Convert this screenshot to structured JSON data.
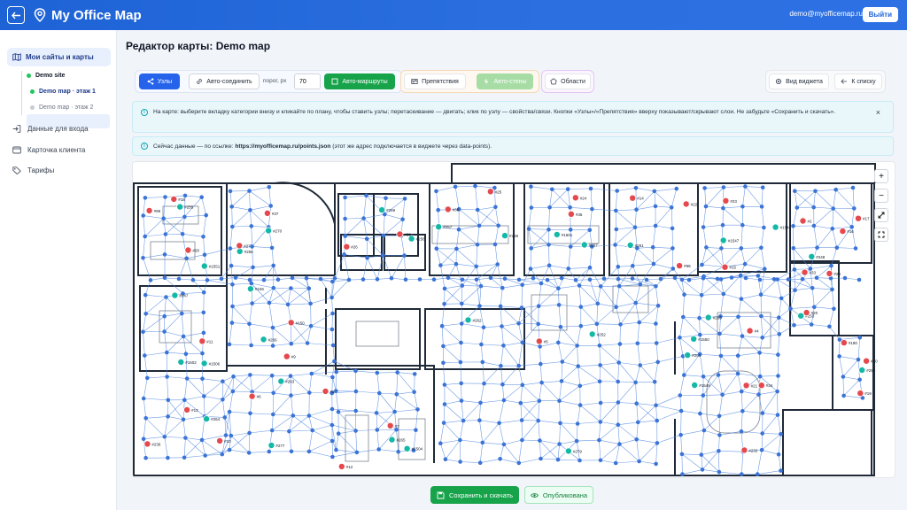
{
  "header": {
    "title": "My Office Map",
    "user_email": "demo@myofficemap.ru",
    "logout_label": "Выйти"
  },
  "sidebar": {
    "sites_label": "Мои сайты и карты",
    "site_name": "Demo site",
    "maps": [
      {
        "label": "Demo map · этаж 1",
        "active": true
      },
      {
        "label": "Demo map · этаж 2",
        "active": false
      }
    ],
    "nav": [
      {
        "label": "Данные для входа",
        "icon": "login-icon"
      },
      {
        "label": "Карточка клиента",
        "icon": "card-icon"
      },
      {
        "label": "Тарифы",
        "icon": "tag-icon"
      }
    ]
  },
  "page": {
    "title": "Редактор карты: Demo map"
  },
  "toolbar": {
    "nodes_label": "Узлы",
    "autoconnect_label": "Авто-соединить",
    "threshold_label": "порог, px",
    "threshold_value": "70",
    "autoroutes_label": "Авто-маршруты",
    "obstacles_label": "Препятствия",
    "autowalls_label": "Авто-стены",
    "areas_label": "Области",
    "widget_view_label": "Вид виджета",
    "back_to_list_label": "К списку"
  },
  "info": {
    "hint_text": "На карте: выберите вкладку категории внизу и кликайте по плану, чтобы ставить узлы; перетаскивание — двигать; клик по узлу — свойства/связи. Кнопки «Узлы»/«Препятствия» вверху показывают/скрывают слои. Не забудьте «Сохранить и скачать».",
    "data_prefix": "Сейчас данные — по ссылке:",
    "data_url": "https://myofficemap.ru/points.json",
    "data_suffix": "(этот же адрес подключается в виджете через data-points)."
  },
  "map": {
    "zoom_in": "+",
    "zoom_out": "−",
    "labels": [
      "#99",
      "#270",
      "#269",
      "#268",
      "#267",
      "#98",
      "#1547",
      "#248",
      "#1602",
      "#266",
      "#265",
      "#264",
      "#263",
      "#262",
      "#261",
      "#1549",
      "#253",
      "#254",
      "#255",
      "#256",
      "#258",
      "#257",
      "#1601",
      "#251",
      "#1548",
      "#2",
      "#1506",
      "#150",
      "#1504",
      "#236",
      "#277",
      "#279",
      "#283",
      "#232",
      "#29",
      "#30",
      "#28",
      "#27",
      "#26",
      "#25",
      "#24",
      "#14",
      "#15",
      "#16",
      "#11",
      "#9",
      "#7",
      "#10",
      "#8",
      "#252",
      "#1550",
      "#34",
      "#33",
      "#19",
      "#18",
      "#37",
      "#38",
      "#36",
      "#35",
      "#22",
      "#23",
      "#17",
      "#247",
      "#246",
      "#12",
      "#13",
      "#6",
      "#5",
      "#4",
      "#21",
      "#20",
      "#180",
      "#1551"
    ],
    "colors": {
      "node": "#3b74d6",
      "edge": "#4b83de",
      "desk_marker": "#e5484d",
      "meeting_marker": "#14b8a6",
      "wall": "#1f2937"
    }
  },
  "footer": {
    "save_label": "Сохранить и скачать",
    "published_label": "Опубликована"
  }
}
